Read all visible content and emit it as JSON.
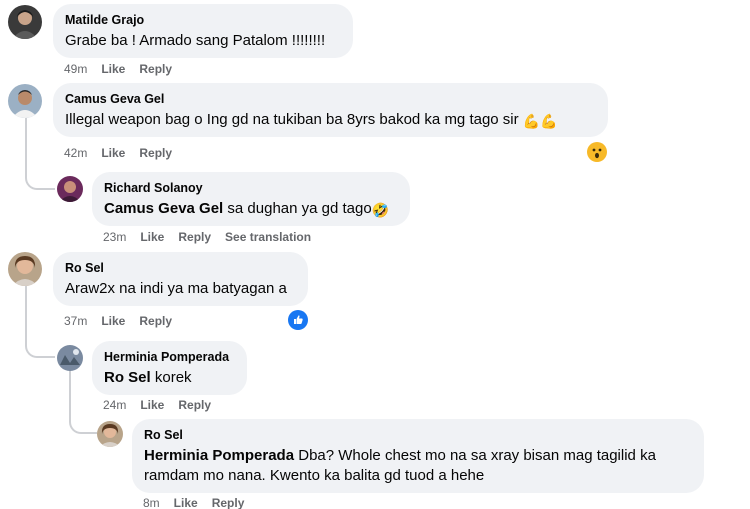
{
  "comments": [
    {
      "author": "Matilde Grajo",
      "text": "Grabe ba ! Armado sang Patalom !!!!!!!!",
      "time": "49m",
      "like": "Like",
      "reply": "Reply"
    },
    {
      "author": "Camus Geva Gel",
      "text": "Illegal weapon bag o Ing gd na tukiban ba 8yrs bakod ka mg tago sir",
      "emoji": "💪💪",
      "time": "42m",
      "like": "Like",
      "reply": "Reply",
      "reaction": "wow-reaction-icon",
      "replies": [
        {
          "author": "Richard Solanoy",
          "mention": "Camus Geva Gel",
          "text": " sa dughan ya gd tago",
          "emoji": "🤣",
          "time": "23m",
          "like": "Like",
          "reply": "Reply",
          "see_translation": "See translation"
        }
      ]
    },
    {
      "author": "Ro Sel",
      "text": "Araw2x na indi ya ma batyagan a",
      "time": "37m",
      "like": "Like",
      "reply": "Reply",
      "reaction": "like-reaction-icon",
      "replies": [
        {
          "author": "Herminia Pomperada",
          "mention": "Ro Sel",
          "text": " korek",
          "time": "24m",
          "like": "Like",
          "reply": "Reply"
        },
        {
          "author": "Ro Sel",
          "mention": "Herminia Pomperada",
          "text_line1": " Dba? Whole chest mo na sa xray bisan mag tagilid ka",
          "text_line2": "ramdam mo nana. Kwento ka balita gd tuod a hehe",
          "time": "8m",
          "like": "Like",
          "reply": "Reply"
        }
      ]
    }
  ],
  "colors": {
    "bubble": "#f0f2f5",
    "meta": "#65676b",
    "like_blue": "#1877f2",
    "wow_yellow": "#f7b928"
  }
}
